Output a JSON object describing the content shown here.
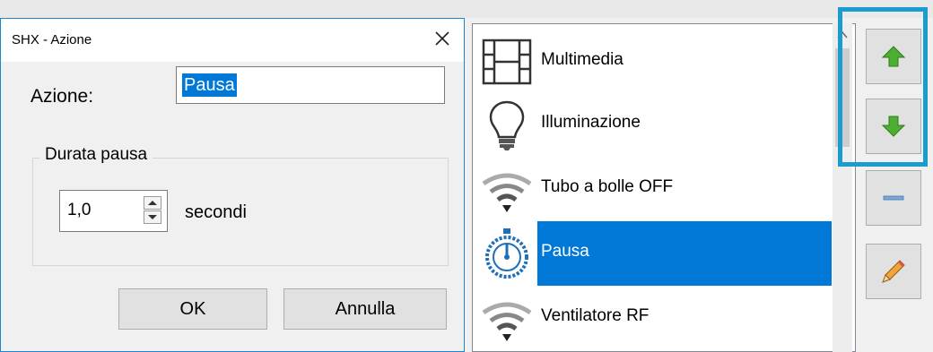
{
  "dialog": {
    "title": "SHX - Azione",
    "close_icon": "close-icon",
    "azione_label": "Azione:",
    "azione_value": "Pausa",
    "group_label": "Durata pausa",
    "duration_value": "1,0",
    "unit_label": "secondi",
    "ok_label": "OK",
    "cancel_label": "Annulla"
  },
  "list": {
    "items": [
      {
        "label": "Multimedia",
        "icon": "film-icon",
        "selected": false
      },
      {
        "label": "Illuminazione",
        "icon": "lightbulb-icon",
        "selected": false
      },
      {
        "label": "Tubo a bolle OFF",
        "icon": "wifi-icon",
        "selected": false
      },
      {
        "label": "Pausa",
        "icon": "stopwatch-icon",
        "selected": true
      },
      {
        "label": "Ventilatore RF",
        "icon": "wifi-icon",
        "selected": false
      }
    ]
  },
  "side_buttons": [
    {
      "icon": "arrow-up-icon",
      "color": "#3fa52c"
    },
    {
      "icon": "arrow-down-icon",
      "color": "#3fa52c"
    },
    {
      "icon": "minus-icon",
      "color": "#7aa7d8"
    },
    {
      "icon": "pencil-icon",
      "color": "#e0852a"
    }
  ],
  "colors": {
    "selection": "#0078d7",
    "highlight": "#1b9cd0"
  }
}
